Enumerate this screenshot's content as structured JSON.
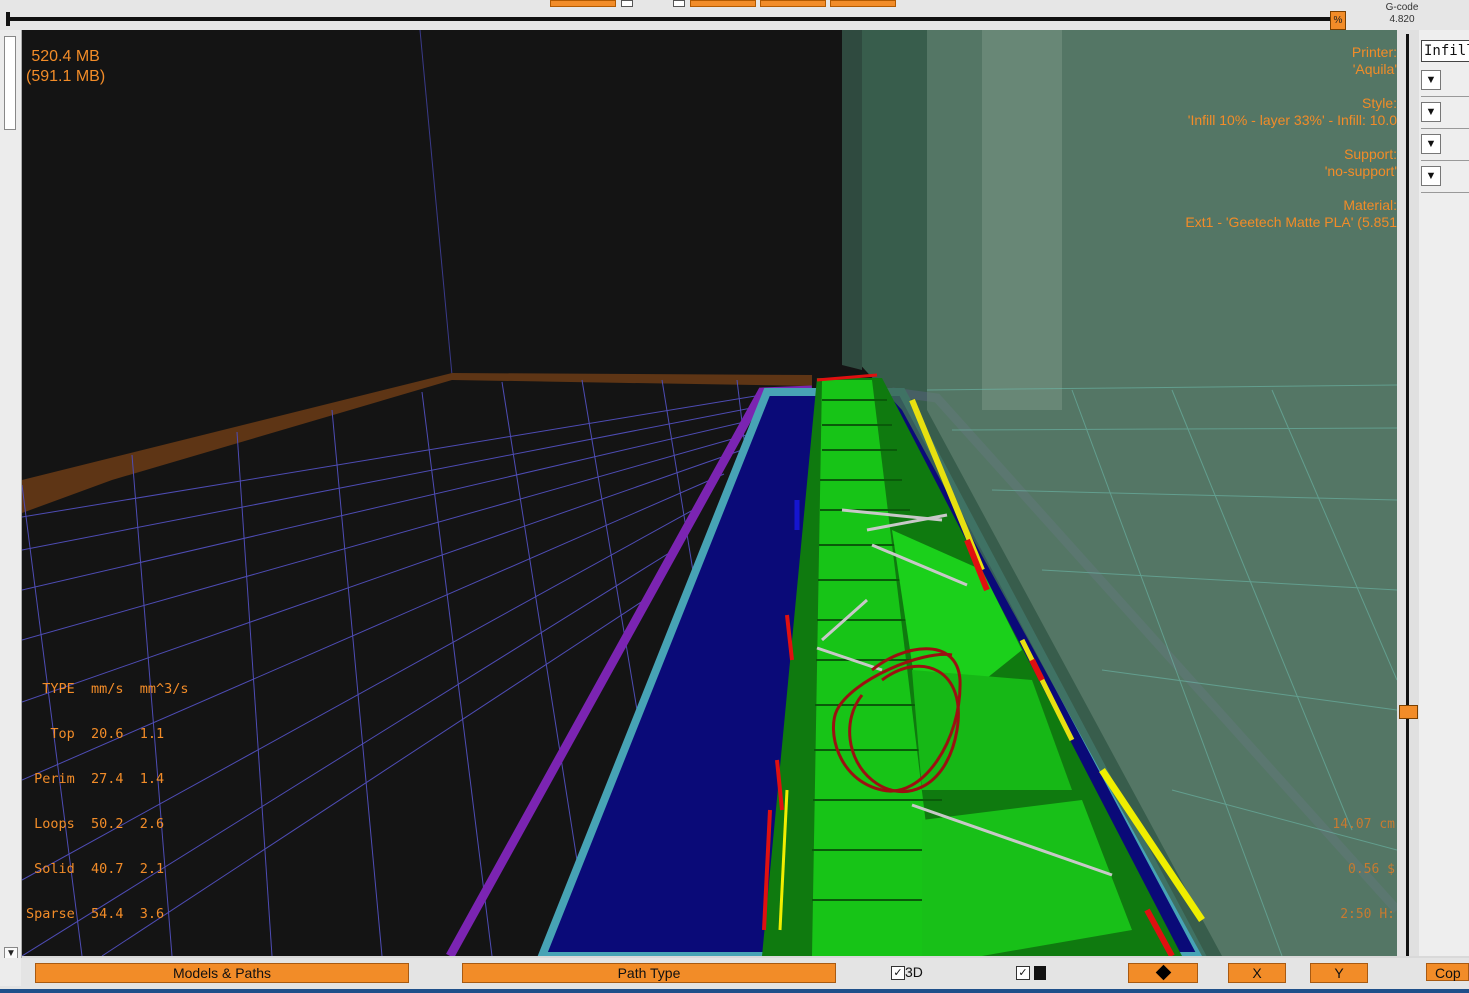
{
  "toolbar": {
    "slider_percent_label": "%",
    "gcode_label": "G-code",
    "gcode_value": "4.820"
  },
  "viewport": {
    "memory_used": "520.4 MB",
    "memory_total": "(591.1 MB)",
    "printer_label": "Printer:",
    "printer_value": "'Aquila'",
    "style_label": "Style:",
    "style_value": "'Infill 10% - layer 33%' - Infill: 10.0",
    "support_label": "Support:",
    "support_value": "'no-support'",
    "material_label": "Material:",
    "material_value": "Ext1 - 'Geetech Matte PLA' (5.851",
    "speeds_header": "  TYPE  mm/s  mm^3/s",
    "speeds_rows": [
      "   Top  20.6  1.1",
      " Perim  27.4  1.4",
      " Loops  50.2  2.6",
      " Solid  40.7  2.1",
      "Sparse  54.4  3.6"
    ],
    "stat_length": "14.07 cm",
    "stat_cost": "0.56 $",
    "stat_time": "2:50 H:"
  },
  "right_panel": {
    "filter_value": "Infill",
    "dropdown_glyph": "▼"
  },
  "bottom": {
    "models_paths_label": "Models & Paths",
    "path_type_label": "Path Type",
    "check_3d_label": "3D",
    "check_mark": "✓",
    "x_label": "X",
    "y_label": "Y",
    "copy_label": "Cop"
  },
  "colors": {
    "accent": "#f28c28",
    "bed_grid": "#5a56c8",
    "skirt": "#7a1fa8",
    "infill": "#13c113",
    "support_base": "#0b0b7a"
  }
}
